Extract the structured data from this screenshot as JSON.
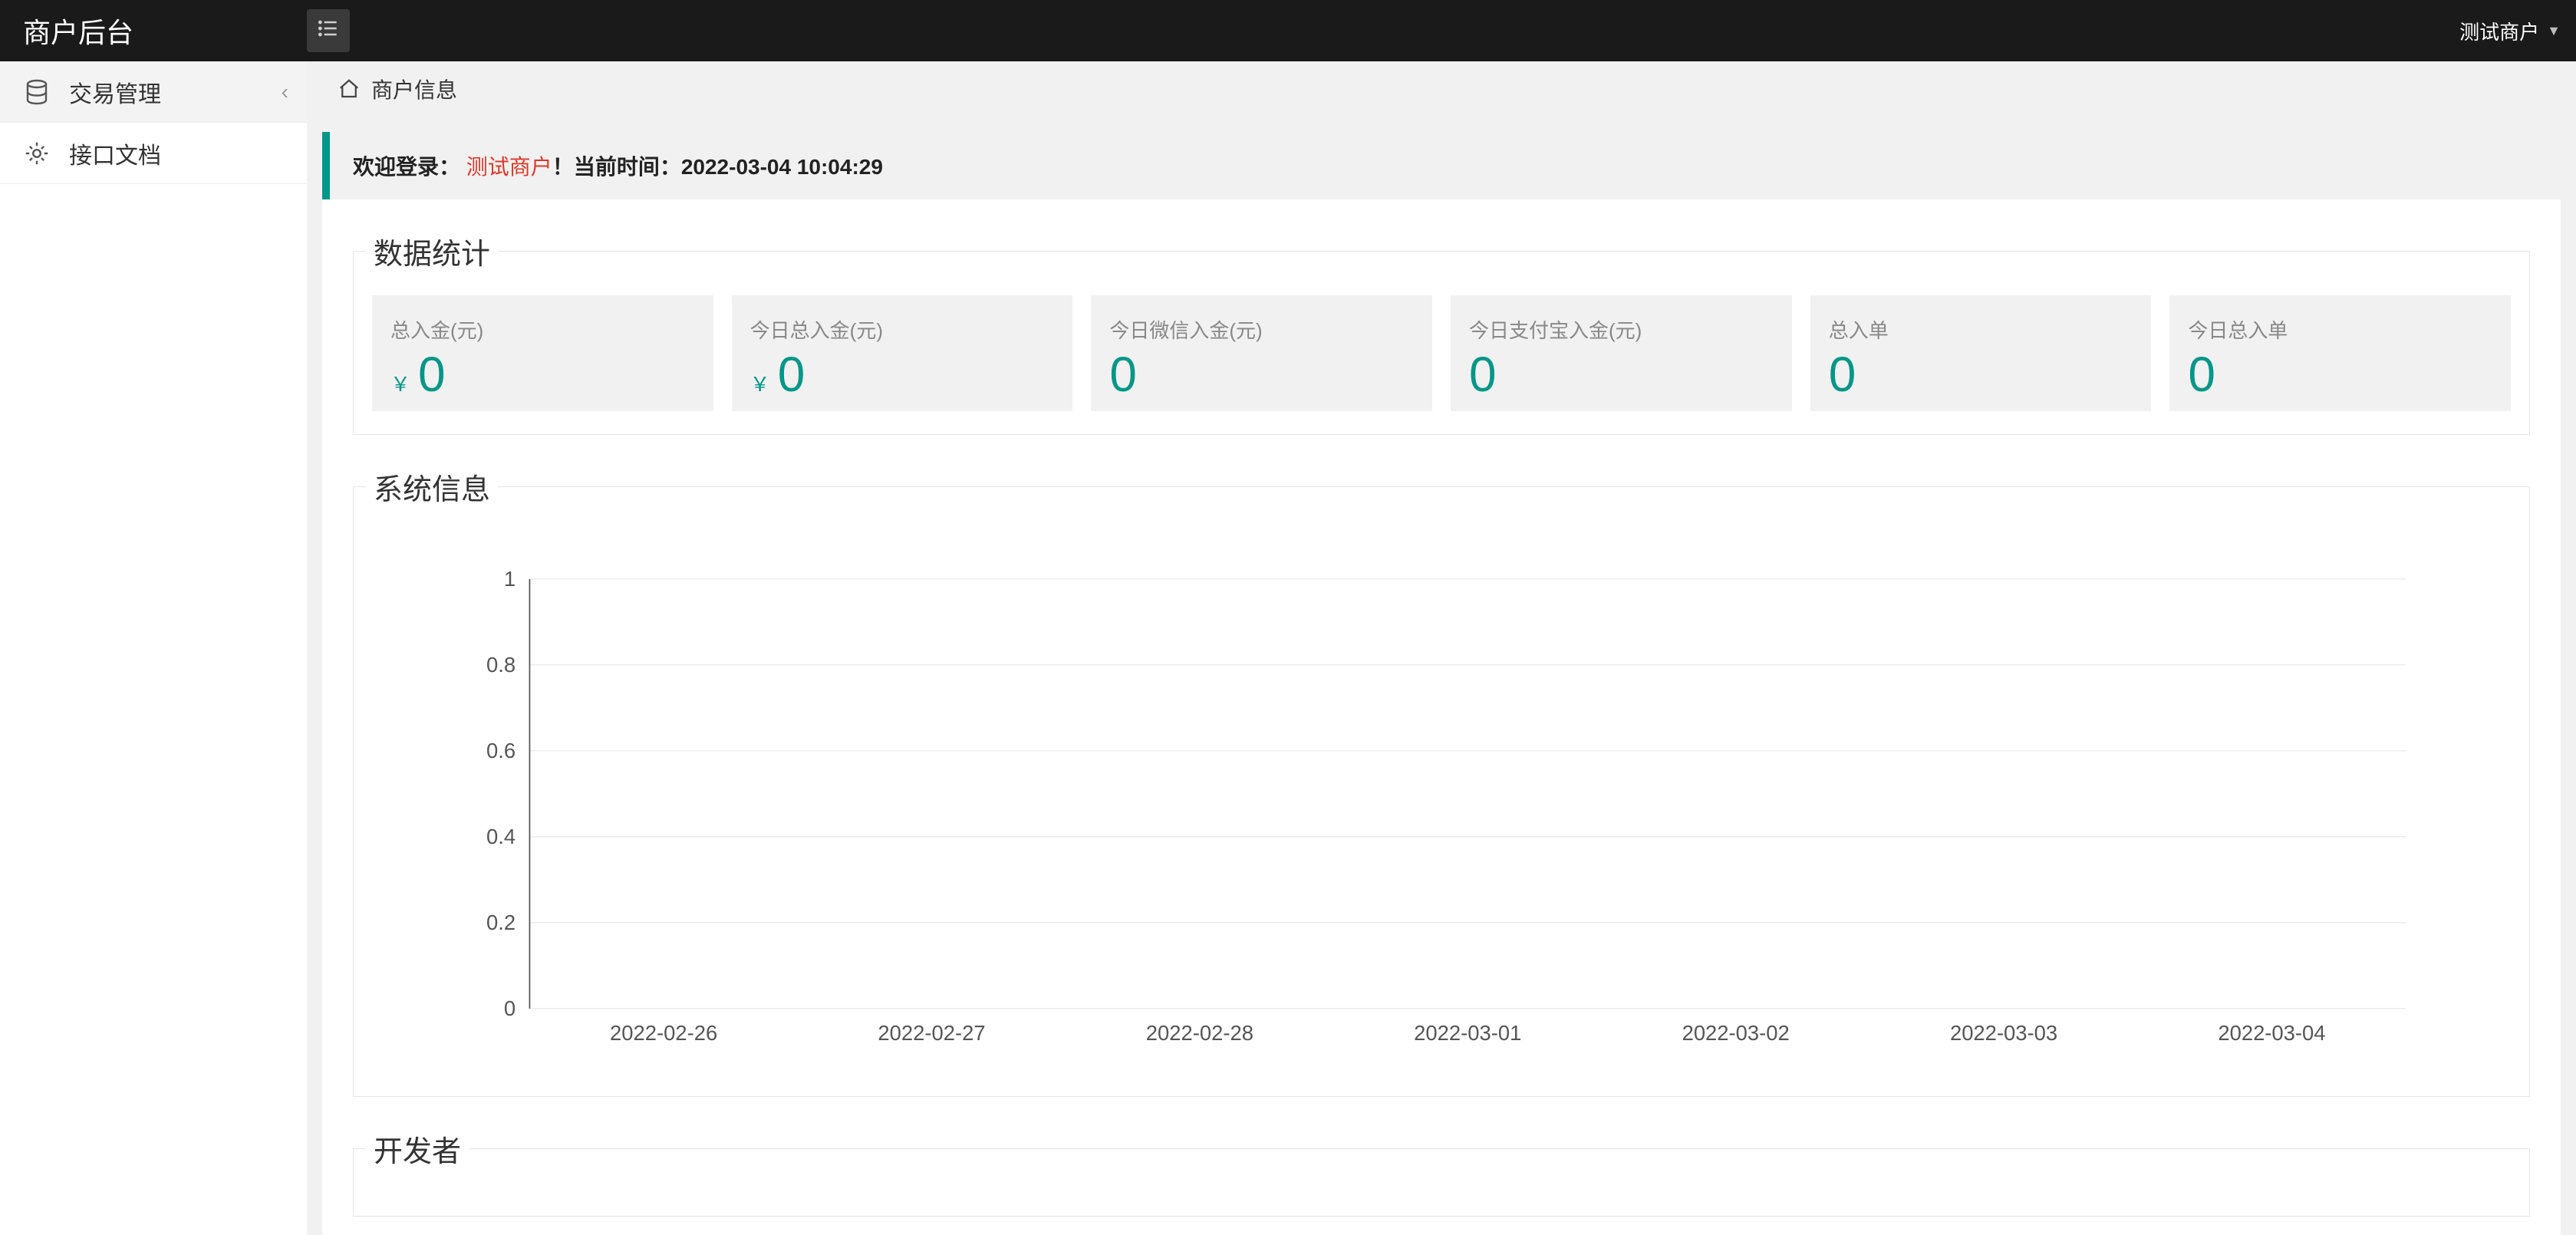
{
  "header": {
    "brand": "商户后台",
    "user": "测试商户"
  },
  "sidebar": {
    "items": [
      {
        "icon": "database-icon",
        "label": "交易管理",
        "has_children": true
      },
      {
        "icon": "gear-icon",
        "label": "接口文档",
        "has_children": false
      }
    ]
  },
  "breadcrumb": {
    "title": "商户信息"
  },
  "welcome": {
    "prefix": "欢迎登录：",
    "name": "测试商户",
    "suffix": "！当前时间：",
    "time": "2022-03-04 10:04:29"
  },
  "stats_legend": "数据统计",
  "stats": [
    {
      "label": "总入金(元)",
      "prefix": "￥",
      "value": "0"
    },
    {
      "label": "今日总入金(元)",
      "prefix": "￥",
      "value": "0"
    },
    {
      "label": "今日微信入金(元)",
      "prefix": "",
      "value": "0"
    },
    {
      "label": "今日支付宝入金(元)",
      "prefix": "",
      "value": "0"
    },
    {
      "label": "总入单",
      "prefix": "",
      "value": "0"
    },
    {
      "label": "今日总入单",
      "prefix": "",
      "value": "0"
    }
  ],
  "sysinfo_legend": "系统信息",
  "developer_legend": "开发者",
  "chart_data": {
    "type": "line",
    "categories": [
      "2022-02-26",
      "2022-02-27",
      "2022-02-28",
      "2022-03-01",
      "2022-03-02",
      "2022-03-03",
      "2022-03-04"
    ],
    "values": [
      0,
      0,
      0,
      0,
      0,
      0,
      0
    ],
    "title": "",
    "xlabel": "",
    "ylabel": "",
    "ylim": [
      0,
      1
    ],
    "yticks": [
      0,
      0.2,
      0.4,
      0.6,
      0.8,
      1
    ]
  }
}
